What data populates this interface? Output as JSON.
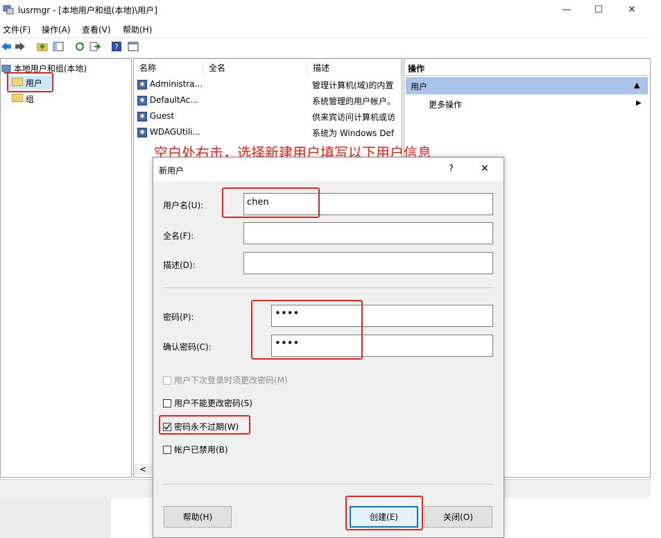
{
  "window": {
    "title": "lusrmgr - [本地用户和组(本地)\\用户]",
    "minimize_glyph": "—",
    "maximize_glyph": "☐",
    "close_glyph": "✕"
  },
  "menu": [
    "文件(F)",
    "操作(A)",
    "查看(V)",
    "帮助(H)"
  ],
  "toolbar_icons": [
    "back-arrow-icon",
    "forward-arrow-icon",
    "up-folder-icon",
    "show-hide-tree-icon",
    "refresh-icon",
    "export-list-icon",
    "help-icon",
    "properties-icon"
  ],
  "tree": {
    "root": "本地用户和组(本地)",
    "children": [
      "用户",
      "组"
    ]
  },
  "list": {
    "columns": [
      "名称",
      "全名",
      "描述"
    ],
    "rows": [
      {
        "name": "Administra...",
        "fullname": "",
        "description": "管理计算机(域)的内置"
      },
      {
        "name": "DefaultAc...",
        "fullname": "",
        "description": "系统管理的用户帐户。"
      },
      {
        "name": "Guest",
        "fullname": "",
        "description": "供来宾访问计算机或访"
      },
      {
        "name": "WDAGUtili...",
        "fullname": "",
        "description": "系统为 Windows Def"
      }
    ],
    "scroll_left_glyph": "<"
  },
  "actions": {
    "header": "操作",
    "section": "用户",
    "section_arrow": "▲",
    "more": "更多操作",
    "more_arrow": "▶"
  },
  "annotation": "空白处右击，选择新建用户填写以下用户信息",
  "dialog": {
    "title": "新用户",
    "help_glyph": "?",
    "close_glyph": "✕",
    "username_label": "用户名(U):",
    "username_value": "chen",
    "fullname_label": "全名(F):",
    "fullname_value": "",
    "description_label": "描述(D):",
    "description_value": "",
    "password_label": "密码(P):",
    "password_value": "••••",
    "confirm_label": "确认密码(C):",
    "confirm_value": "••••",
    "checkboxes": [
      {
        "label": "用户下次登录时须更改密码(M)",
        "checked": false,
        "enabled": false
      },
      {
        "label": "用户不能更改密码(S)",
        "checked": false,
        "enabled": true
      },
      {
        "label": "密码永不过期(W)",
        "checked": true,
        "enabled": true
      },
      {
        "label": "帐户已禁用(B)",
        "checked": false,
        "enabled": true
      }
    ],
    "buttons": {
      "help": "帮助(H)",
      "create": "创建(E)",
      "close": "关闭(O)"
    }
  },
  "colors": {
    "annotation_red": "#e8231b",
    "selection_blue": "#cce8ff",
    "actions_blue": "#a9c4e8"
  }
}
